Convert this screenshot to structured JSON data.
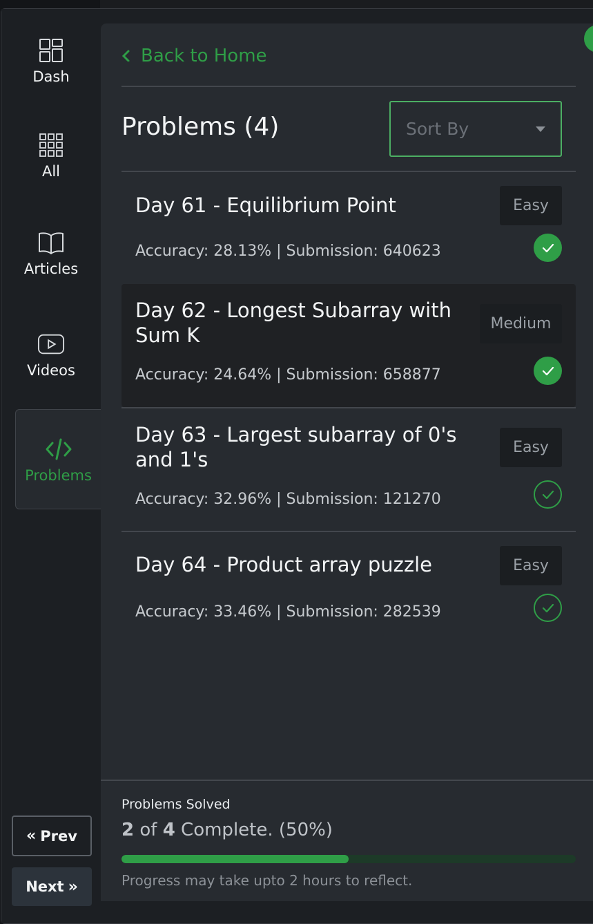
{
  "sidebar": {
    "items": [
      {
        "label": "Dash",
        "icon": "dashboard-icon"
      },
      {
        "label": "All",
        "icon": "grid-icon"
      },
      {
        "label": "Articles",
        "icon": "book-icon"
      },
      {
        "label": "Videos",
        "icon": "video-icon"
      },
      {
        "label": "Problems",
        "icon": "code-icon",
        "active": true
      }
    ],
    "prev_label": "Prev",
    "next_label": "Next"
  },
  "header": {
    "back_label": "Back to Home",
    "title": "Problems (4)",
    "sort_placeholder": "Sort By"
  },
  "problems": [
    {
      "title": "Day 61 - Equilibrium Point",
      "meta": "Accuracy: 28.13% | Submission: 640623",
      "difficulty": "Easy",
      "status": "solved"
    },
    {
      "title": "Day 62 - Longest Subarray with Sum K",
      "meta": "Accuracy: 24.64% | Submission: 658877",
      "difficulty": "Medium",
      "status": "solved"
    },
    {
      "title": "Day 63 - Largest subarray of 0's and 1's",
      "meta": "Accuracy: 32.96% | Submission: 121270",
      "difficulty": "Easy",
      "status": "unsolved"
    },
    {
      "title": "Day 64 - Product array puzzle",
      "meta": "Accuracy: 33.46% | Submission: 282539",
      "difficulty": "Easy",
      "status": "unsolved"
    }
  ],
  "footer": {
    "label": "Problems Solved",
    "solved": "2",
    "of_text": "of",
    "total": "4",
    "complete_text": "Complete. (50%)",
    "progress": 0.5,
    "note": "Progress may take upto 2 hours to reflect."
  },
  "colors": {
    "accent": "#2f9e47",
    "panel": "#272b30",
    "sidebar": "#1c1f23"
  }
}
